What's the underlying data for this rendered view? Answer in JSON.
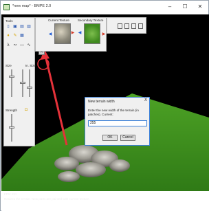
{
  "window": {
    "title": "*new map* - BMPE 2.0",
    "minimize_icon": "minimize-icon",
    "maximize_icon": "maximize-icon",
    "close_icon": "close-icon"
  },
  "tools_panel": {
    "header": "Tools",
    "size_label": "Size",
    "size_value": "In. Size",
    "strength_label": "Strength"
  },
  "texture_panel": {
    "current_label": "Current Texture",
    "secondary_label": "Secondary Texture"
  },
  "dialog": {
    "title": "New terrain width",
    "close_label": "X",
    "prompt": "Enter the new width of the terrain (in patches). Current:",
    "input_value": "255",
    "ok_label": "OK",
    "cancel_label": "Cancel"
  },
  "status": {
    "fps": "FPS: 211",
    "message": "Resizes the terrain. New parts are painted with current texture."
  },
  "colors": {
    "annotation": "#e5323a",
    "terrain": "#3d8f1e",
    "sky": "#000000"
  }
}
